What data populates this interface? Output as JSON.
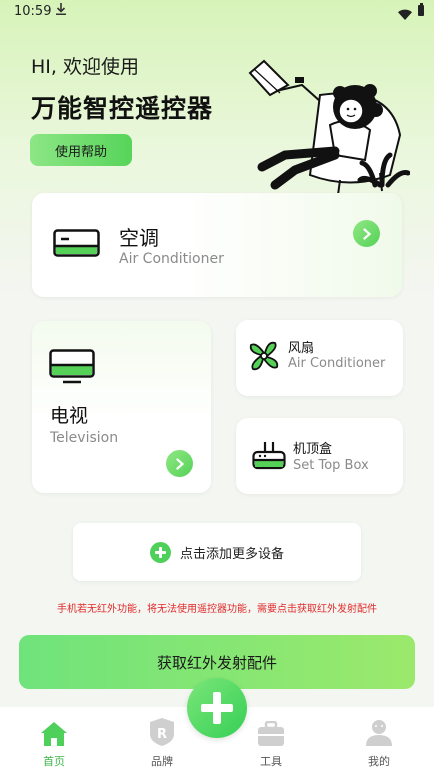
{
  "status_bar": {
    "time": "10:59",
    "download_icon": "download-icon",
    "wifi_icon": "wifi-icon",
    "battery_icon": "battery-icon"
  },
  "header": {
    "greeting": "HI, 欢迎使用",
    "title": "万能智控遥控器",
    "help_button": "使用帮助"
  },
  "devices": {
    "air_conditioner": {
      "title": "空调",
      "subtitle": "Air Conditioner",
      "icon": "air-conditioner-icon"
    },
    "television": {
      "title": "电视",
      "subtitle": "Television",
      "icon": "tv-icon"
    },
    "fan": {
      "title": "风扇",
      "subtitle": "Air Conditioner",
      "icon": "fan-icon"
    },
    "set_top_box": {
      "title": "机顶盒",
      "subtitle": "Set Top Box",
      "icon": "router-icon"
    }
  },
  "add_more": {
    "label": "点击添加更多设备"
  },
  "warning": "手机若无红外功能，将无法使用遥控器功能，需要点击获取红外发射配件",
  "get_accessory_button": "获取红外发射配件",
  "bottom_nav": {
    "items": [
      {
        "label": "首页",
        "icon": "home-icon",
        "active": true
      },
      {
        "label": "品牌",
        "icon": "brand-shield-icon",
        "active": false
      },
      {
        "label": "工具",
        "icon": "toolbox-icon",
        "active": false
      },
      {
        "label": "我的",
        "icon": "user-icon",
        "active": false
      }
    ]
  },
  "colors": {
    "accent": "#4fd05a",
    "warning": "#e12b2b",
    "subtitle": "#8a8a8a"
  }
}
